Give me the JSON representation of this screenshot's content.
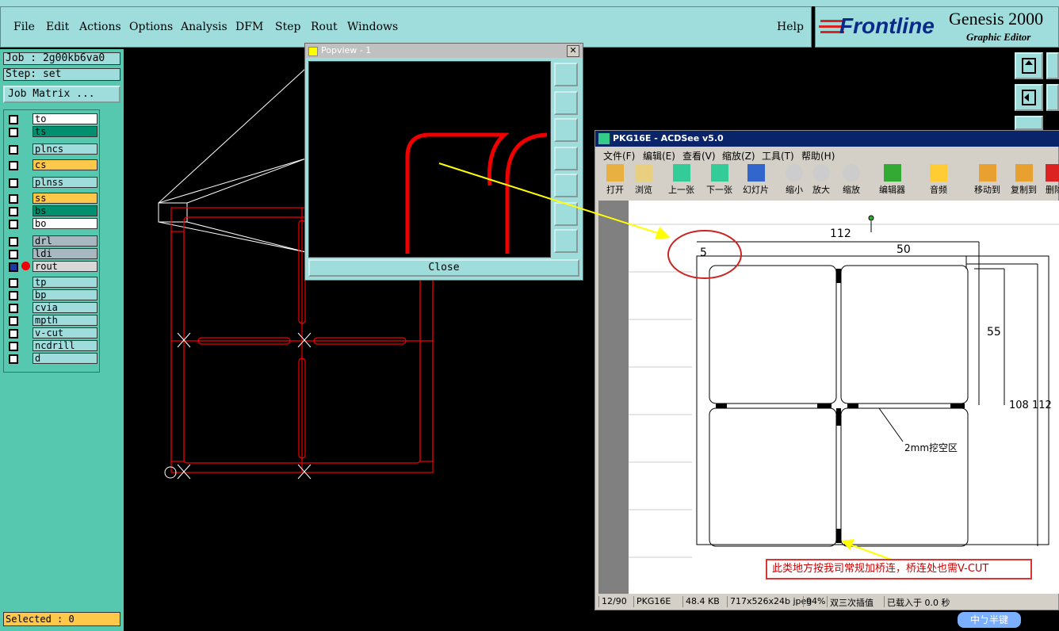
{
  "menu": {
    "items": [
      "File",
      "Edit",
      "Actions",
      "Options",
      "Analysis",
      "DFM",
      "Step",
      "Rout",
      "Windows"
    ],
    "help": "Help"
  },
  "logo": {
    "brand": "Frontline",
    "product": "Genesis 2000",
    "subtitle": "Graphic Editor"
  },
  "info": {
    "job": "Job : 2g00kb6va0",
    "step": "Step: set",
    "job_matrix": "Job Matrix ..."
  },
  "layers": [
    {
      "name": "to",
      "color": "#ffffff"
    },
    {
      "name": "ts",
      "color": "#009070"
    },
    {
      "name": "plncs",
      "color": "#9fdcdc"
    },
    {
      "name": "cs",
      "color": "#ffc84a"
    },
    {
      "name": "plnss",
      "color": "#9fdcdc"
    },
    {
      "name": "ss",
      "color": "#ffc84a"
    },
    {
      "name": "bs",
      "color": "#009070"
    },
    {
      "name": "bo",
      "color": "#ffffff"
    },
    {
      "name": "drl",
      "color": "#a8b8c0"
    },
    {
      "name": "ldi",
      "color": "#a8b8c0"
    },
    {
      "name": "rout",
      "color": "#d8d8d8"
    },
    {
      "name": "tp",
      "color": "#9fdcdc"
    },
    {
      "name": "bp",
      "color": "#9fdcdc"
    },
    {
      "name": "cvia",
      "color": "#9fdcdc"
    },
    {
      "name": "mpth",
      "color": "#9fdcdc"
    },
    {
      "name": "v-cut",
      "color": "#9fdcdc"
    },
    {
      "name": "ncdrill",
      "color": "#9fdcdc"
    },
    {
      "name": "d",
      "color": "#9fdcdc"
    }
  ],
  "selected": "Selected : 0",
  "popview": {
    "title": "Popview - 1",
    "close_label": "Close",
    "close_x": "✕"
  },
  "acdsee": {
    "title": "PKG16E - ACDSee v5.0",
    "menu": [
      "文件(F)",
      "编辑(E)",
      "查看(V)",
      "缩放(Z)",
      "工具(T)",
      "帮助(H)"
    ],
    "tools": [
      "打开",
      "浏览",
      "上一张",
      "下一张",
      "幻灯片",
      "缩小",
      "放大",
      "缩放",
      "编辑器",
      "音频",
      "移动到",
      "复制到",
      "删除"
    ],
    "status": [
      "12/90",
      "PKG16E",
      "48.4 KB",
      "717x526x24b jpeg",
      "94%",
      "双三次插值",
      "已载入于 0.0 秒"
    ]
  },
  "drawing": {
    "dim_112_top": "112",
    "dim_50": "50",
    "dim_5": "5",
    "dim_55": "55",
    "dim_108_112": "108 112",
    "label_2mm": "2mm挖空区"
  },
  "note": "此类地方按我司常规加桥连，桥连处也需V-CUT",
  "ime": "中ㄅ半键"
}
